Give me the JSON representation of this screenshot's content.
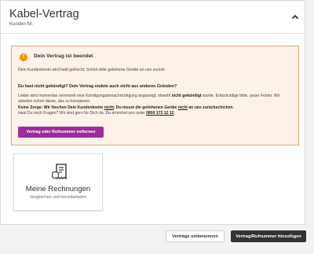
{
  "header": {
    "title": "Kabel-Vertrag",
    "subtitle": "Kunden-Nr."
  },
  "alert": {
    "icon": "info-icon",
    "icon_glyph": "!",
    "title": "Dein Vertrag ist beendet",
    "line1": "Dein Kundenkonto wird bald gelöscht. Schick bitte geliehene Geräte an uns zurück.",
    "question": "Du hast nicht gekündigt? Dein Vertrag endete auch nicht aus anderen Gründen?",
    "line2_a": "Leider wird momentan vereinzelt eine Kündigungsbenachrichtigung angezeigt, obwohl ",
    "line2_b": "nicht gekündigt",
    "line2_c": " wurde. Entschuldige bitte, unser Fehler. Wir",
    "line3": "arbeiten schon daran, das zu korrigieren.",
    "line4_a": "Keine Sorge: Wir löschen Dein Kundenkonto ",
    "line4_b": "nicht",
    "line4_c": ". Du musst die geliehenen Geräte ",
    "line4_d": "nicht",
    "line4_e": " an uns zurückschicken.",
    "line5_a": "Hast Du noch Fragen? Wir sind gern für Dich da. Du erreichst uns unter ",
    "phone": "0800 172 12 12",
    "line5_b": ".",
    "button": "Vertrag oder Rufnummer entfernen"
  },
  "bills": {
    "icon": "invoice-icon",
    "title": "Meine Rechnungen",
    "subtitle": "Vergleichen und herunterladen"
  },
  "footer": {
    "rename": "Verträge umbenennen",
    "add": "Vertrag/Rufnummer hinzufügen"
  },
  "colors": {
    "accent": "#9c2aa0",
    "alert_bg": "#fdf1e8",
    "alert_border": "#e8a27c",
    "warning": "#eb9700",
    "dark_button": "#333333"
  }
}
